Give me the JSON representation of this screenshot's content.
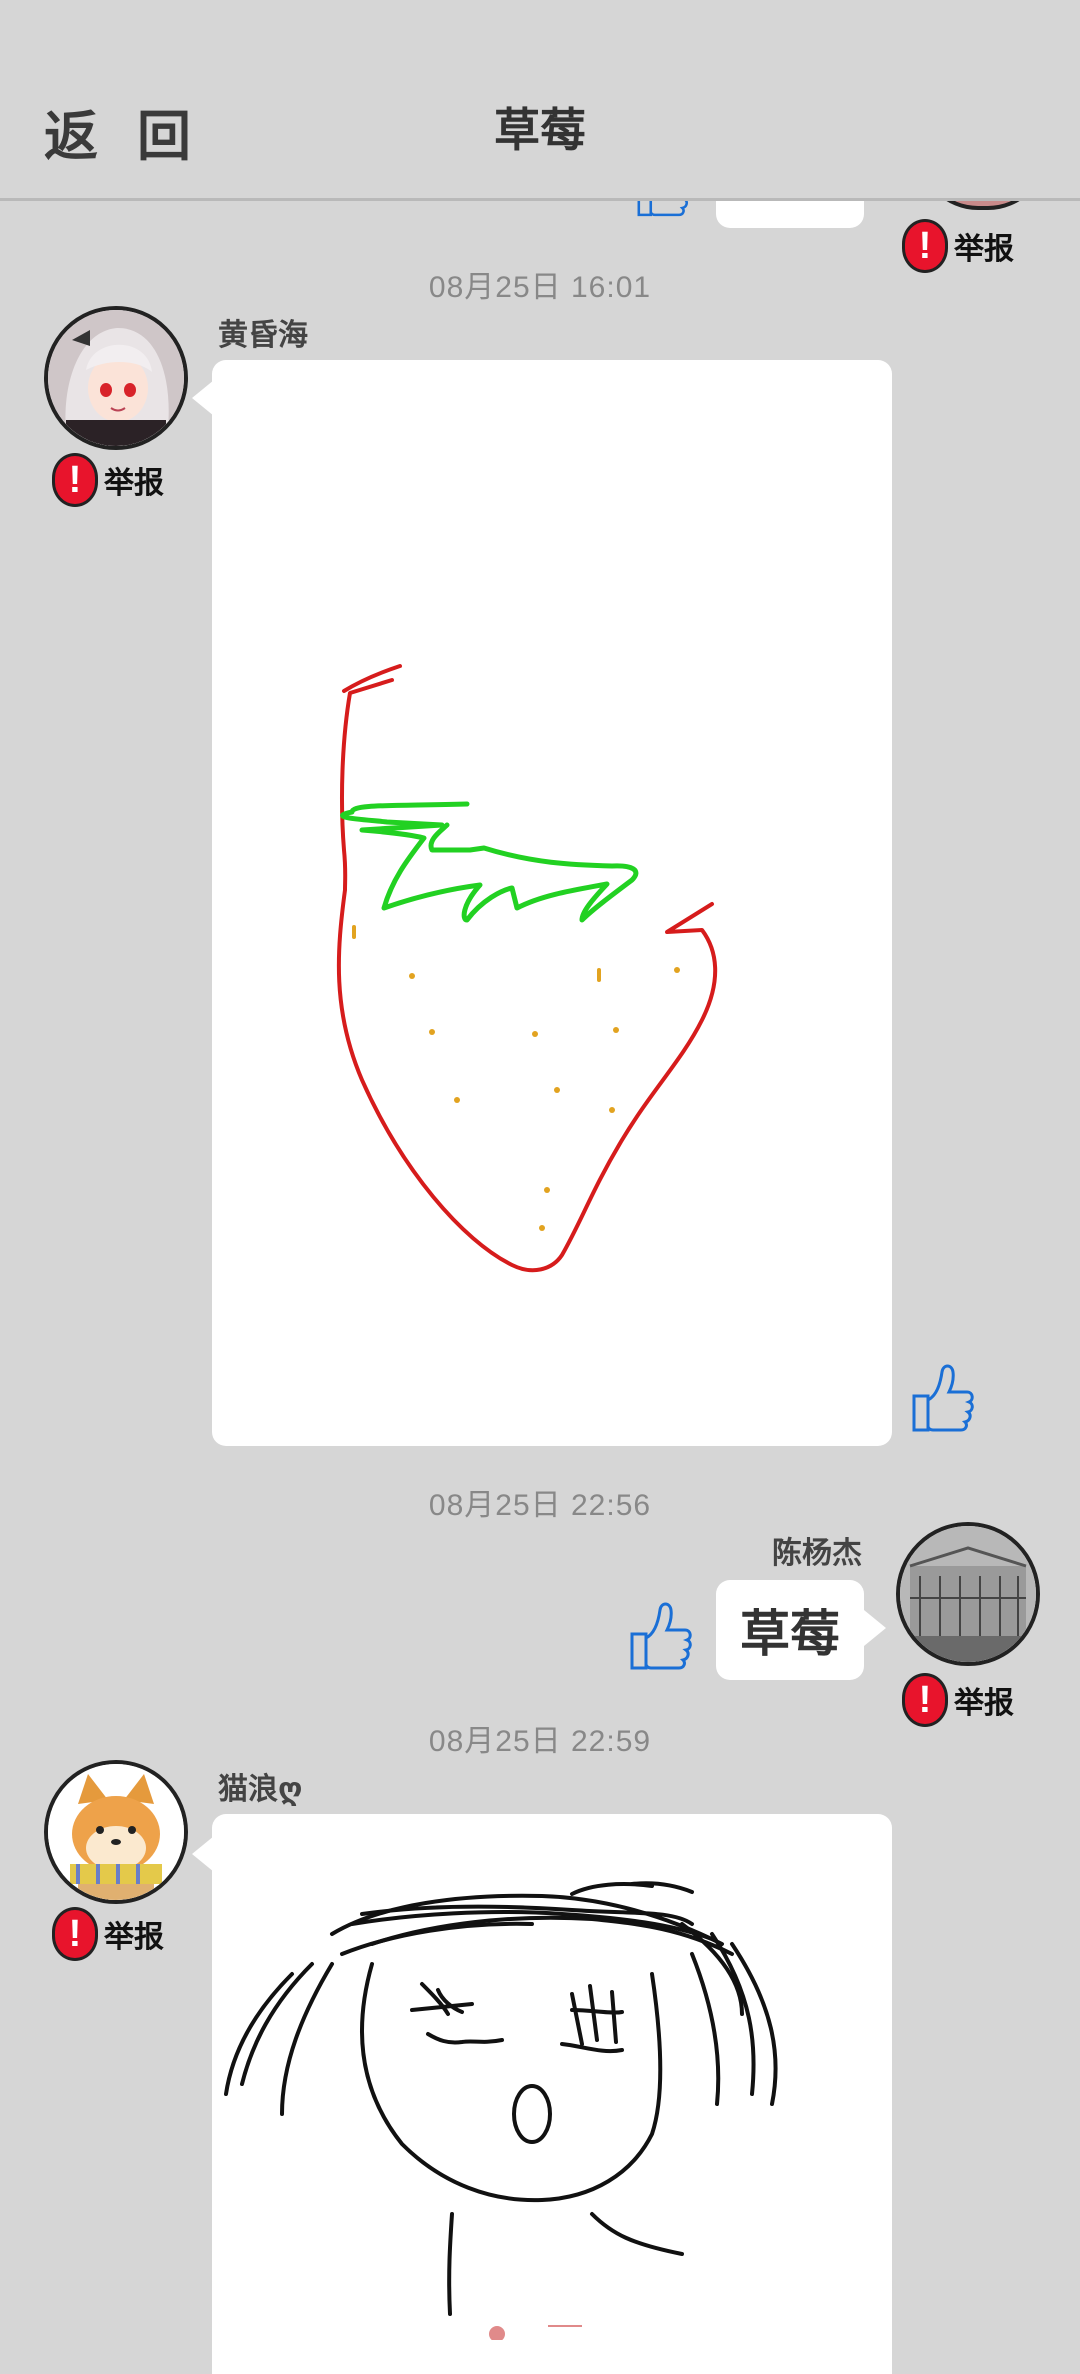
{
  "header": {
    "back_label": "返 回",
    "title": "草莓"
  },
  "report_label": "举报",
  "messages": [
    {
      "time": "08月25日  16:01",
      "user": "黄昏海",
      "type": "drawing",
      "drawing": "strawberry"
    },
    {
      "time": "08月25日  22:56",
      "user": "陈杨杰",
      "type": "text",
      "text": "草莓"
    },
    {
      "time": "08月25日  22:59",
      "user": "猫浪ღ",
      "type": "drawing",
      "drawing": "face-sketch"
    }
  ],
  "colors": {
    "background": "#d6d6d6",
    "report_red": "#e8142c",
    "like_blue": "#1a6fd6"
  },
  "icons": [
    "like-thumb-icon",
    "report-exclamation-icon"
  ]
}
